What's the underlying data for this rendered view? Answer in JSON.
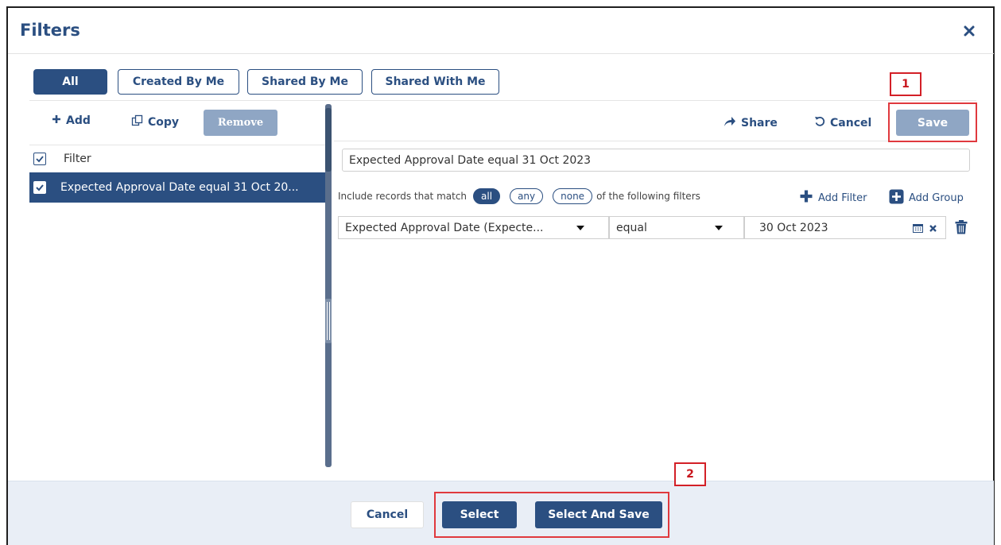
{
  "dialog": {
    "title": "Filters",
    "close_icon": "close-icon"
  },
  "tabs": [
    {
      "label": "All",
      "active": true
    },
    {
      "label": "Created By Me",
      "active": false
    },
    {
      "label": "Shared By Me",
      "active": false
    },
    {
      "label": "Shared With Me",
      "active": false
    }
  ],
  "left_toolbar": {
    "add_label": "Add",
    "copy_label": "Copy",
    "remove_label": "Remove"
  },
  "filter_list": {
    "header_label": "Filter",
    "header_checked": true,
    "rows": [
      {
        "label": "Expected Approval Date equal 31 Oct 20...",
        "checked": true,
        "selected": true
      }
    ]
  },
  "right_toolbar": {
    "share_label": "Share",
    "cancel_label": "Cancel",
    "save_label": "Save"
  },
  "filter_editor": {
    "name_value": "Expected Approval Date equal 31 Oct 2023",
    "match_prefix": "Include records that match",
    "match_options": [
      {
        "label": "all",
        "active": true
      },
      {
        "label": "any",
        "active": false
      },
      {
        "label": "none",
        "active": false
      }
    ],
    "match_suffix": "of the following filters",
    "add_filter_label": "Add Filter",
    "add_group_label": "Add Group",
    "condition": {
      "field": "Expected Approval Date (Expecte...",
      "operator": "equal",
      "value": "30 Oct 2023"
    }
  },
  "footer": {
    "cancel_label": "Cancel",
    "select_label": "Select",
    "select_and_save_label": "Select And Save"
  },
  "callouts": [
    {
      "number": "1"
    },
    {
      "number": "2"
    }
  ],
  "colors": {
    "primary": "#2b4f81",
    "disabled_button": "#8fa6c4",
    "callout_red": "#e0393e",
    "footer_bg": "#e9eef6"
  }
}
